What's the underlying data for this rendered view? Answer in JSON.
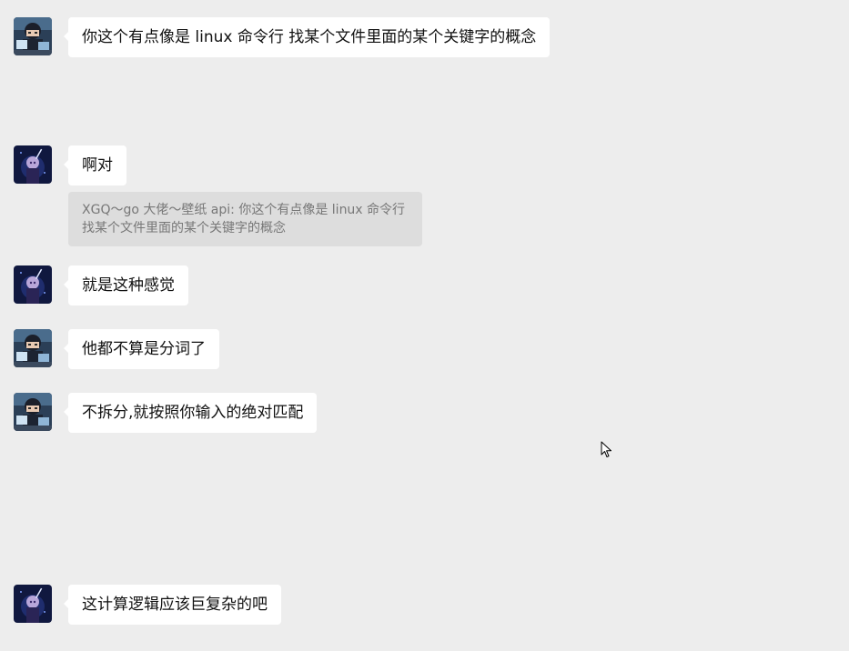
{
  "messages": [
    {
      "sender": "avatar-a",
      "text": "你这个有点像是 linux 命令行 找某个文件里面的某个关键字的概念"
    },
    {
      "sender": "avatar-b",
      "text": "啊对",
      "quote": "XGQ～go 大佬～壁纸 api: 你这个有点像是 linux 命令行 找某个文件里面的某个关键字的概念"
    },
    {
      "sender": "avatar-b",
      "text": "就是这种感觉"
    },
    {
      "sender": "avatar-a",
      "text": "他都不算是分词了"
    },
    {
      "sender": "avatar-a",
      "text": "不拆分,就按照你输入的绝对匹配"
    },
    {
      "sender": "avatar-b",
      "text": "这计算逻辑应该巨复杂的吧"
    }
  ],
  "colors": {
    "background": "#ededed",
    "bubble": "#ffffff",
    "quote_background": "#dddddd",
    "quote_text": "#777777"
  }
}
